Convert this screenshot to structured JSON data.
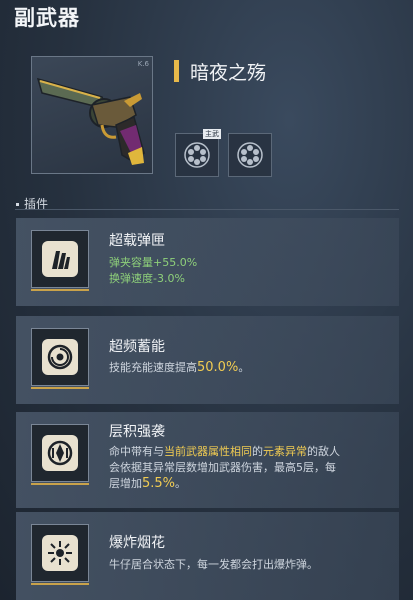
{
  "page": {
    "title": "副武器"
  },
  "weapon": {
    "name": "暗夜之殇",
    "corner_tag": "K.6"
  },
  "slots": {
    "badge": "主武"
  },
  "section": {
    "title": "插件"
  },
  "plugins": [
    {
      "name": "超载弹匣",
      "icon": "magazine-icon",
      "lines": [
        "弹夹容量+55.0%",
        "换弹速度-3.0%"
      ]
    },
    {
      "name": "超频蓄能",
      "icon": "energy-swirl-icon",
      "text": "技能充能速度提高",
      "value": "50.0%",
      "suffix": "。"
    },
    {
      "name": "层积强袭",
      "icon": "layered-blade-icon",
      "p1": "命中带有与",
      "hl1": "当前武器属性相同",
      "p2": "的",
      "hl2": "元素异常",
      "p3": "的敌人",
      "line2": "会依据其异常层数增加武器伤害，最高5层，每",
      "p4": "层增加",
      "value": "5.5%",
      "suffix": "。"
    },
    {
      "name": "爆炸烟花",
      "icon": "firework-icon",
      "text": "牛仔居合状态下，每一发都会打出爆炸弹。"
    }
  ],
  "colors": {
    "accent_gold": "#f1cc52",
    "positive_green": "#8ed07a",
    "card_bg": "#4a586a"
  }
}
